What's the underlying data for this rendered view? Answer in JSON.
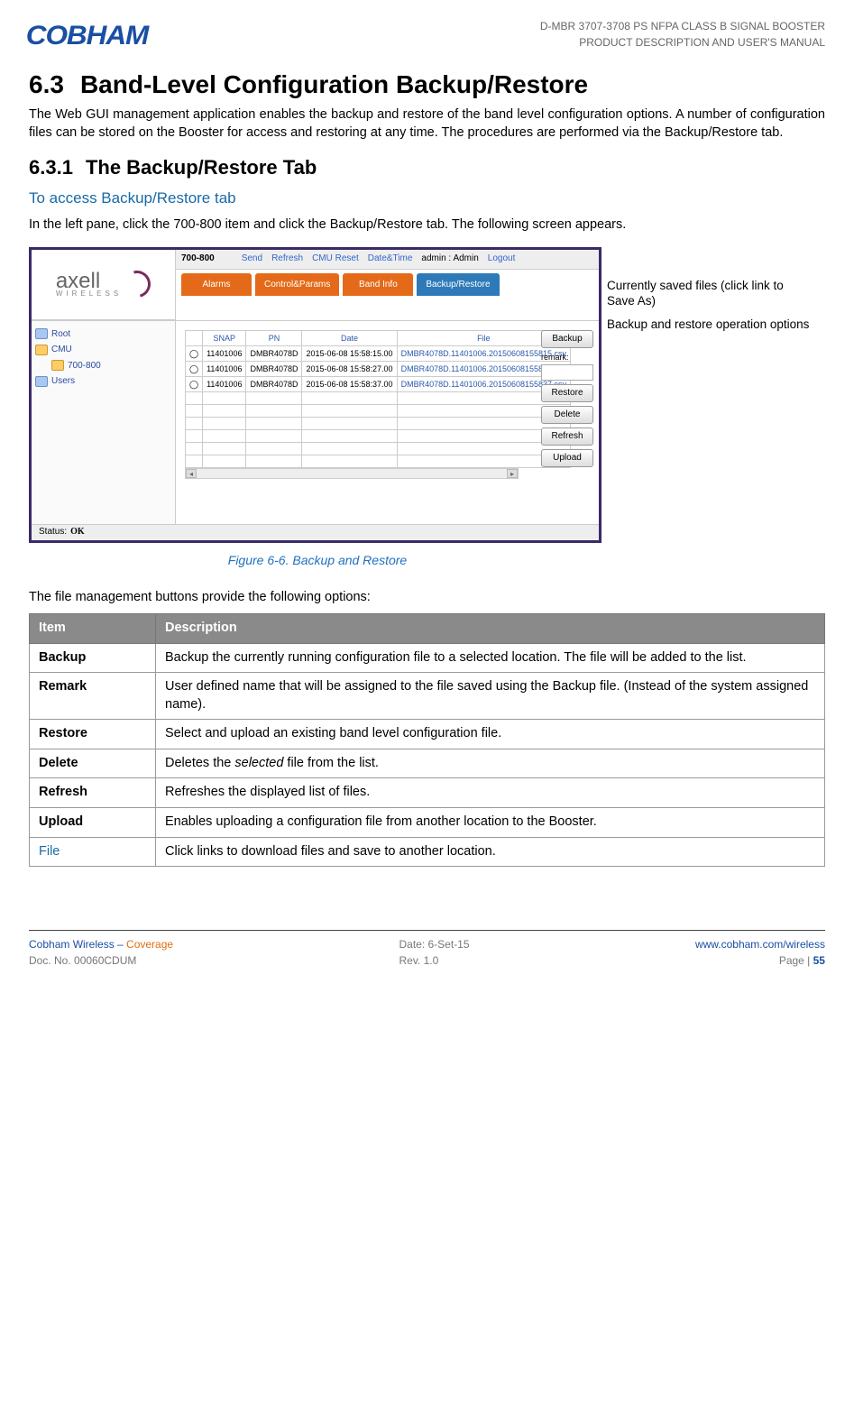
{
  "header": {
    "logo_text": "COBHAM",
    "line1": "D-MBR 3707-3708 PS NFPA CLASS B SIGNAL BOOSTER",
    "line2": "PRODUCT DESCRIPTION AND USER'S MANUAL"
  },
  "section": {
    "number": "6.3",
    "title": "Band-Level Configuration Backup/Restore",
    "para": "The Web GUI management application enables the backup and restore of the band level configuration options. A number of configuration files can be stored on the Booster for access and restoring at any time. The procedures are performed via the Backup/Restore tab."
  },
  "subsection": {
    "number": "6.3.1",
    "title": "The Backup/Restore Tab"
  },
  "blue_heading": "To access Backup/Restore tab",
  "instruction_para": "In the left pane, click the 700-800 item and click the Backup/Restore tab. The following screen appears.",
  "app": {
    "logo_main": "axell",
    "logo_sub": "WIRELESS",
    "band_label": "700-800",
    "top_links": [
      "Send",
      "Refresh",
      "CMU Reset",
      "Date&Time"
    ],
    "admin_text": "admin : Admin",
    "logout": "Logout",
    "tabs": [
      "Alarms",
      "Control&Params",
      "Band Info",
      "Backup/Restore"
    ],
    "active_tab_index": 3,
    "tree": [
      {
        "label": "Root",
        "icon": "blue"
      },
      {
        "label": "CMU",
        "icon": "yellow"
      },
      {
        "label": "700-800",
        "icon": "yellow",
        "indent": true
      },
      {
        "label": "Users",
        "icon": "blue"
      }
    ],
    "table": {
      "headers": [
        "",
        "SNAP",
        "PN",
        "Date",
        "File"
      ],
      "rows": [
        {
          "snap": "11401006",
          "pn": "DMBR4078D",
          "date": "2015-06-08 15:58:15.00",
          "file": "DMBR4078D.11401006.20150608155815.csv"
        },
        {
          "snap": "11401006",
          "pn": "DMBR4078D",
          "date": "2015-06-08 15:58:27.00",
          "file": "DMBR4078D.11401006.20150608155827.csv"
        },
        {
          "snap": "11401006",
          "pn": "DMBR4078D",
          "date": "2015-06-08 15:58:37.00",
          "file": "DMBR4078D.11401006.20150608155837.csv"
        }
      ],
      "empty_rows": 6
    },
    "buttons": {
      "backup": "Backup",
      "remark_label": "remark:",
      "restore": "Restore",
      "delete": "Delete",
      "refresh": "Refresh",
      "upload": "Upload"
    },
    "status_prefix": "Status:",
    "status_value": "OK"
  },
  "callouts": {
    "c1": "Currently saved files (click link to Save As)",
    "c2": "Backup and restore operation options"
  },
  "figure_caption": "Figure 6-6. Backup and Restore",
  "options_intro": "The file management buttons provide the following options:",
  "options_table": {
    "headers": [
      "Item",
      "Description"
    ],
    "rows": [
      {
        "item": "Backup",
        "desc": "Backup the currently running configuration file to a selected location. The file will be added to the list."
      },
      {
        "item": "Remark",
        "desc": "User defined name that will be assigned to the file saved using the Backup file. (Instead of the system assigned name)."
      },
      {
        "item": "Restore",
        "desc": "Select and upload an existing band level configuration file."
      },
      {
        "item": "Delete",
        "desc_prefix": "Deletes the ",
        "desc_italic": "selected",
        "desc_suffix": " file from the list."
      },
      {
        "item": "Refresh",
        "desc": "Refreshes the displayed list of files."
      },
      {
        "item": "Upload",
        "desc": "Enables uploading a configuration file from another location to the Booster."
      },
      {
        "item": "File",
        "item_class": "file-link",
        "desc": "Click links to download files and save to another location."
      }
    ]
  },
  "footer": {
    "left1_pre": "Cobham Wireless – ",
    "left1_accent": "Coverage",
    "left2": "Doc. No. 00060CDUM",
    "mid1": "Date: 6-Set-15",
    "mid2": "Rev. 1.0",
    "right1": "www.cobham.com/wireless",
    "right2_pre": "Page | ",
    "right2_num": "55"
  }
}
